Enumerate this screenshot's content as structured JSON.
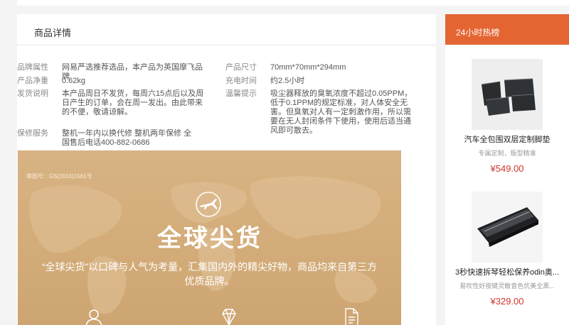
{
  "main": {
    "title": "商品详情",
    "attributes": [
      {
        "key": "品牌属性",
        "value": "网易严选推荐选品，本产品为英国摩飞品牌"
      },
      {
        "key": "产品尺寸",
        "value": "70mm*70mm*294mm"
      },
      {
        "key": "产品净重",
        "value": "0.62kg"
      },
      {
        "key": "充电时间",
        "value": "约2.5小时"
      },
      {
        "key": "发货说明",
        "value": "本产品周日不发货，每周六15点后以及周日产生的订单，会在周一发出。由此带来的不便，敬请谅解。"
      },
      {
        "key": "温馨提示",
        "value": "吸尘器释放的臭氧浓度不超过0.05PPM，低于0.1PPM的规定标准，对人体安全无害。但臭氧对人有一定刺激作用，所以需要在无人封闭条件下使用，使用后适当通风即可散去。"
      },
      {
        "key": "保修服务",
        "value": "整机一年内以换代修 整机两年保修 全国售后电话400-882-0686"
      }
    ],
    "banner": {
      "reg_no": "审图号：GS(2016)1561号",
      "title": "全球尖货",
      "desc": "“全球尖货”以口碑与人气为考量，汇集国内外的精尖好物，商品均来自第三方优质品牌。",
      "icons": [
        "user-icon",
        "diamond-icon",
        "document-icon"
      ]
    }
  },
  "sidebar": {
    "title": "24小时热榜",
    "items": [
      {
        "name": "汽车全包围双层定制脚垫",
        "sub": "专属定制，贩型精准",
        "price": "¥549.00",
        "icon": "car-floor-mat-image"
      },
      {
        "name": "3秒快速拆琴轻松保养odin奥...",
        "sub": "易吹性好按键灵敏音色优美全黑...",
        "price": "¥329.00",
        "icon": "harmonica-image"
      }
    ]
  },
  "colors": {
    "accent": "#e46532",
    "price": "#d0342c",
    "banner": "#d4ae7b"
  }
}
